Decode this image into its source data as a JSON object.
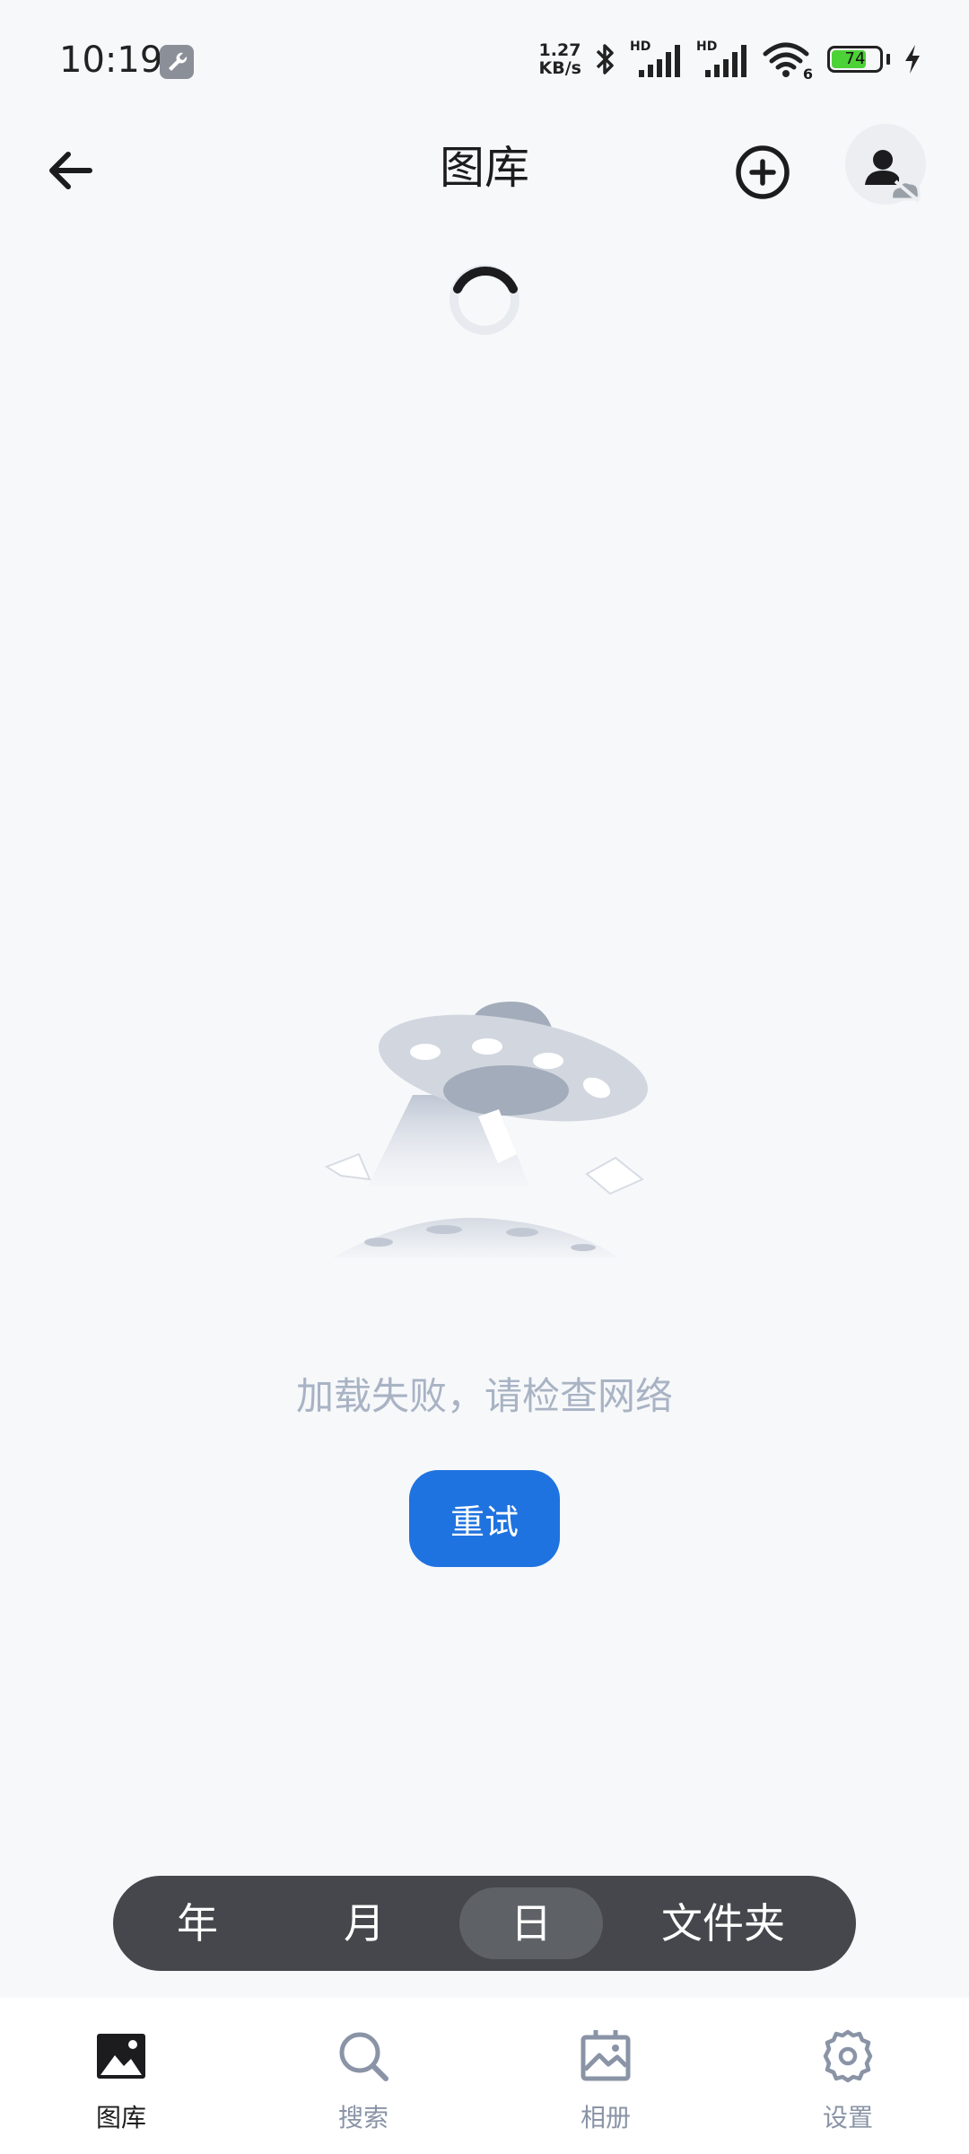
{
  "status_bar": {
    "time": "10:19",
    "net_speed_value": "1.27",
    "net_speed_unit": "KB/s",
    "signal_label_1": "HD",
    "signal_label_2": "HD",
    "wifi_label": "6",
    "battery_level": "74",
    "battery_fraction": 0.74,
    "colors": {
      "battery_fill": "#4cd137"
    }
  },
  "header": {
    "title": "图库",
    "icons": {
      "back": "arrow-left-icon",
      "add": "plus-circle-icon",
      "account": "user-cloud-off-icon"
    }
  },
  "empty_state": {
    "message": "加载失败，请检查网络",
    "retry_label": "重试",
    "colors": {
      "retry_bg": "#1f73e0",
      "message": "#a8b3c4"
    }
  },
  "view_switcher": {
    "options": [
      "年",
      "月",
      "日",
      "文件夹"
    ],
    "selected": "日"
  },
  "bottom_nav": {
    "items": [
      {
        "label": "图库",
        "icon": "gallery-image-icon",
        "active": true
      },
      {
        "label": "搜索",
        "icon": "search-icon",
        "active": false
      },
      {
        "label": "相册",
        "icon": "album-icon",
        "active": false
      },
      {
        "label": "设置",
        "icon": "gear-icon",
        "active": false
      }
    ]
  }
}
